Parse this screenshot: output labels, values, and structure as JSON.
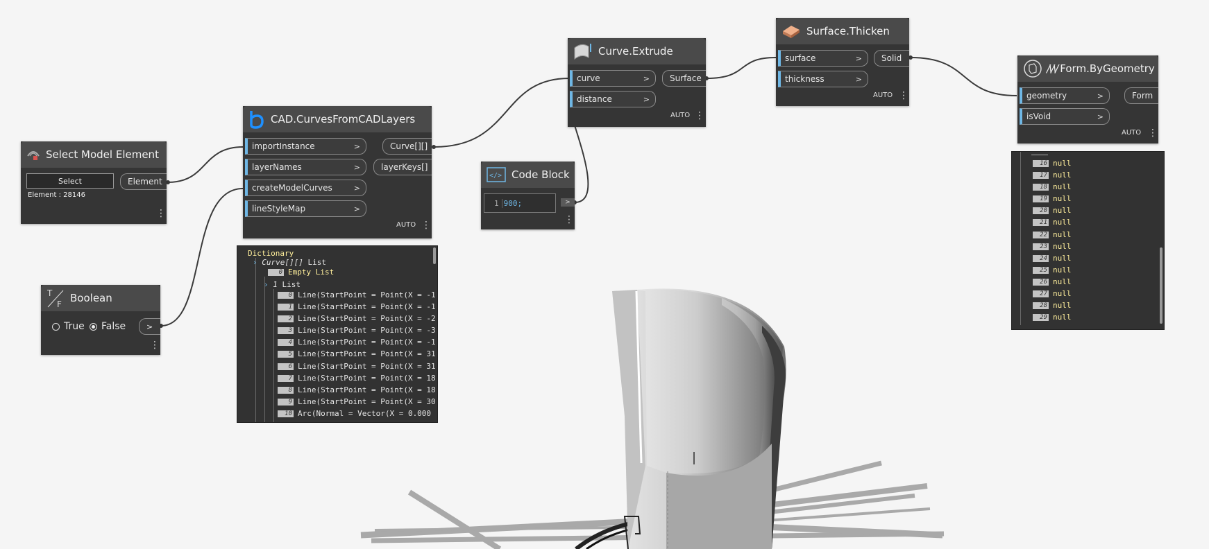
{
  "nodes": {
    "select_model_element": {
      "title": "Select Model Element",
      "button": "Select",
      "output": "Element",
      "info": "Element : 28146"
    },
    "cad_curves": {
      "title": "CAD.CurvesFromCADLayers",
      "inputs": [
        "importInstance",
        "layerNames",
        "createModelCurves",
        "lineStyleMap"
      ],
      "outputs": [
        "Curve[][]",
        "layerKeys[]"
      ],
      "lacing": "AUTO"
    },
    "boolean": {
      "title": "Boolean",
      "true_label": "True",
      "false_label": "False",
      "output_arrow": ">",
      "selected": "False"
    },
    "code_block": {
      "title": "Code Block",
      "line_number": "1",
      "code": "900;",
      "output_arrow": ">"
    },
    "curve_extrude": {
      "title": "Curve.Extrude",
      "inputs": [
        "curve",
        "distance"
      ],
      "output": "Surface",
      "lacing": "AUTO"
    },
    "surface_thicken": {
      "title": "Surface.Thicken",
      "inputs": [
        "surface",
        "thickness"
      ],
      "output": "Solid",
      "lacing": "AUTO"
    },
    "form_by_geometry": {
      "title": "Form.ByGeometry",
      "title_prefix": "/\\/\\/",
      "inputs": [
        "geometry",
        "isVoid"
      ],
      "output": "Form",
      "lacing": "AUTO"
    }
  },
  "cad_preview": {
    "root": "Dictionary",
    "group1_label": "Curve[][]",
    "group1_suffix": "List",
    "empty_index": "0",
    "empty_text": "Empty List",
    "group2_index": "1",
    "group2_label": "List",
    "items": [
      {
        "index": "0",
        "text": "Line(StartPoint = Point(X = -1"
      },
      {
        "index": "1",
        "text": "Line(StartPoint = Point(X = -1"
      },
      {
        "index": "2",
        "text": "Line(StartPoint = Point(X = -2"
      },
      {
        "index": "3",
        "text": "Line(StartPoint = Point(X = -3"
      },
      {
        "index": "4",
        "text": "Line(StartPoint = Point(X = -1"
      },
      {
        "index": "5",
        "text": "Line(StartPoint = Point(X = 31"
      },
      {
        "index": "6",
        "text": "Line(StartPoint = Point(X = 31"
      },
      {
        "index": "7",
        "text": "Line(StartPoint = Point(X = 18"
      },
      {
        "index": "8",
        "text": "Line(StartPoint = Point(X = 18"
      },
      {
        "index": "9",
        "text": "Line(StartPoint = Point(X = 30"
      },
      {
        "index": "10",
        "text": "Arc(Normal = Vector(X = 0.000"
      }
    ]
  },
  "form_preview": {
    "items": [
      {
        "index": "16",
        "text": "null"
      },
      {
        "index": "17",
        "text": "null"
      },
      {
        "index": "18",
        "text": "null"
      },
      {
        "index": "19",
        "text": "null"
      },
      {
        "index": "20",
        "text": "null"
      },
      {
        "index": "21",
        "text": "null"
      },
      {
        "index": "22",
        "text": "null"
      },
      {
        "index": "23",
        "text": "null"
      },
      {
        "index": "24",
        "text": "null"
      },
      {
        "index": "25",
        "text": "null"
      },
      {
        "index": "26",
        "text": "null"
      },
      {
        "index": "27",
        "text": "null"
      },
      {
        "index": "28",
        "text": "null"
      },
      {
        "index": "29",
        "text": "null"
      }
    ]
  },
  "colors": {
    "canvas": "#f5f5f5",
    "node_body": "#353535",
    "node_header": "#4a4a4a",
    "port_accent": "#6fb7e5",
    "preview_text": "#ffef9c",
    "wire": "#3a3a3a"
  }
}
